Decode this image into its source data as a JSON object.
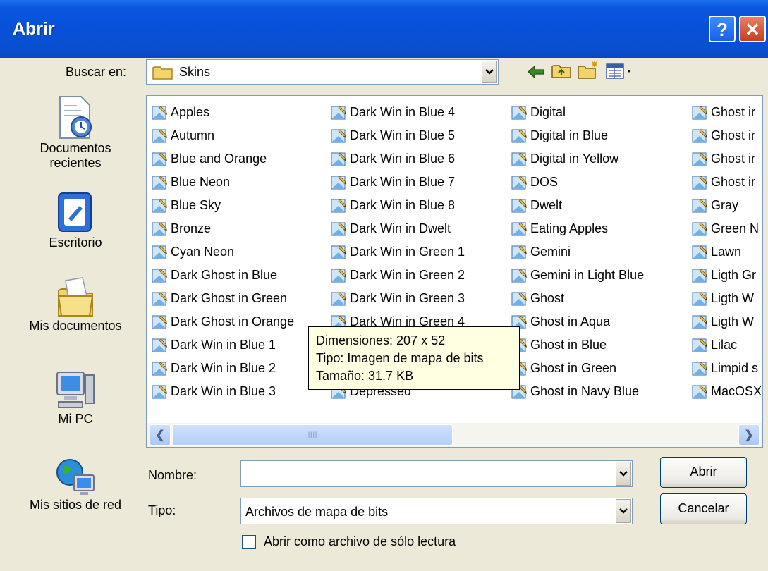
{
  "window": {
    "title": "Abrir",
    "help_label": "?",
    "close_label": "✕"
  },
  "lookin": {
    "label": "Buscar en:",
    "value": "Skins"
  },
  "places": [
    {
      "label_line1": "Documentos",
      "label_line2": "recientes",
      "icon": "recent-documents-icon"
    },
    {
      "label_line1": "Escritorio",
      "label_line2": "",
      "icon": "desktop-icon"
    },
    {
      "label_line1": "Mis documentos",
      "label_line2": "",
      "icon": "my-documents-icon"
    },
    {
      "label_line1": "Mi PC",
      "label_line2": "",
      "icon": "my-computer-icon"
    },
    {
      "label_line1": "Mis sitios de red",
      "label_line2": "",
      "icon": "network-places-icon"
    }
  ],
  "files": {
    "col1": [
      "Apples",
      "Autumn",
      "Blue and Orange",
      "Blue Neon",
      "Blue Sky",
      "Bronze",
      "Cyan Neon",
      "Dark Ghost in Blue",
      "Dark Ghost in Green",
      "Dark Ghost in Orange",
      "Dark Win in Blue 1",
      "Dark Win in Blue 2",
      "Dark Win in Blue 3"
    ],
    "col2": [
      "Dark Win in Blue 4",
      "Dark Win in Blue 5",
      "Dark Win in Blue 6",
      "Dark Win in Blue 7",
      "Dark Win in Blue 8",
      "Dark Win in Dwelt",
      "Dark Win in Green 1",
      "Dark Win in Green 2",
      "Dark Win in Green 3",
      "Dark Win in Green 4",
      "",
      "",
      "Depressed"
    ],
    "col3": [
      "Digital",
      "Digital in Blue",
      "Digital in Yellow",
      "DOS",
      "Dwelt",
      "Eating Apples",
      "Gemini",
      "Gemini in Light Blue",
      "Ghost",
      "Ghost in Aqua",
      "Ghost in Blue",
      "Ghost in Green",
      "Ghost in Navy Blue"
    ],
    "col4": [
      "Ghost ir",
      "Ghost ir",
      "Ghost ir",
      "Ghost ir",
      "Gray",
      "Green N",
      "Lawn",
      "Ligth Gr",
      "Ligth W",
      "Ligth W",
      "Lilac",
      "Limpid s",
      "MacOSX"
    ]
  },
  "tooltip": {
    "line1": "Dimensiones: 207 x 52",
    "line2": "Tipo: Imagen de mapa de bits",
    "line3": "Tamaño: 31.7 KB"
  },
  "filename": {
    "label": "Nombre:",
    "value": ""
  },
  "filetype": {
    "label": "Tipo:",
    "value": "Archivos de mapa de bits"
  },
  "readonly": {
    "label": "Abrir como archivo de sólo lectura",
    "checked": false
  },
  "buttons": {
    "open": "Abrir",
    "cancel": "Cancelar"
  },
  "scrollbar": {
    "grip": "IIII"
  }
}
